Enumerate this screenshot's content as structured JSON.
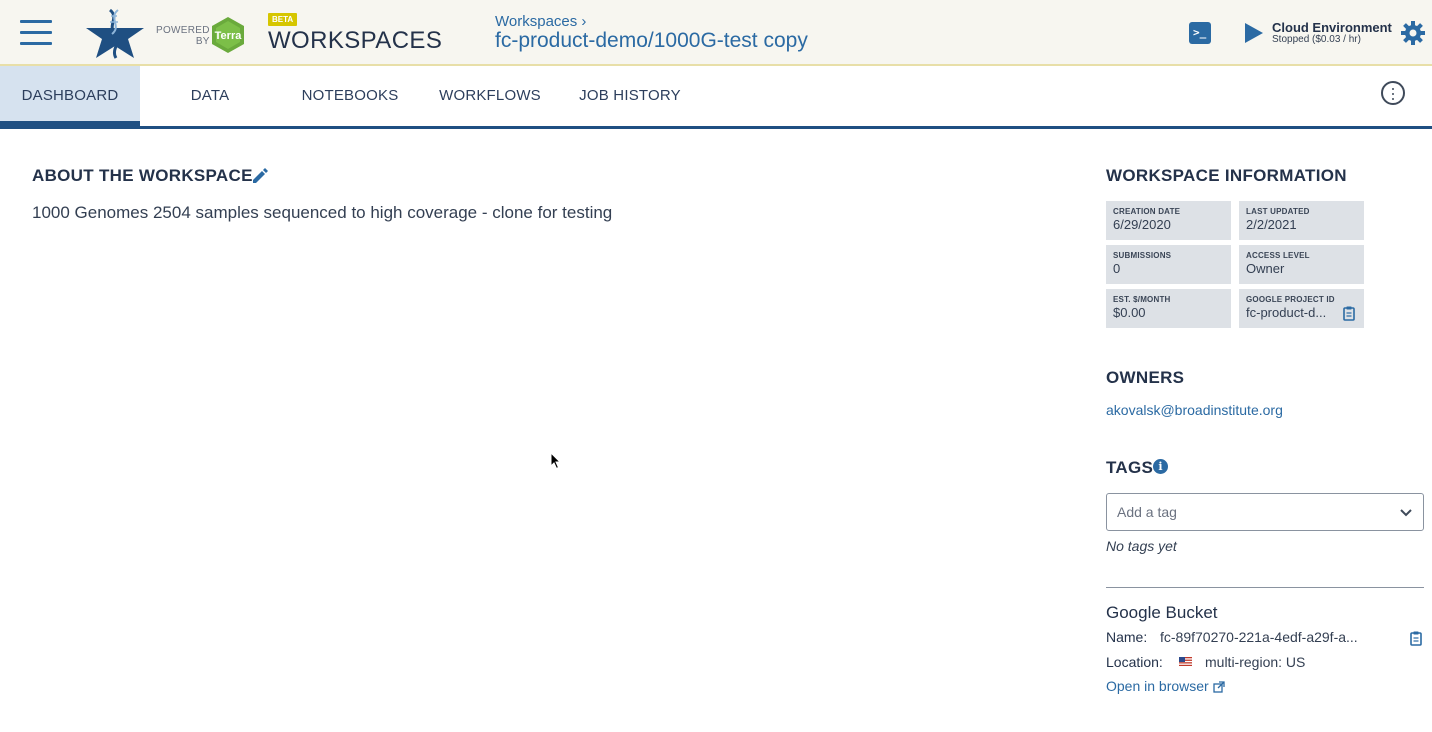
{
  "header": {
    "powered_line1": "POWERED",
    "powered_line2": "BY",
    "terra_label": "Terra",
    "beta_badge": "BETA",
    "app_title": "WORKSPACES",
    "breadcrumb": "Workspaces ›",
    "workspace_name": "fc-product-demo/1000G-test copy",
    "cloud_env_title": "Cloud Environment",
    "cloud_env_status": "Stopped ($0.03 / hr)"
  },
  "tabs": [
    {
      "label": "DASHBOARD",
      "active": true
    },
    {
      "label": "DATA",
      "active": false
    },
    {
      "label": "NOTEBOOKS",
      "active": false
    },
    {
      "label": "WORKFLOWS",
      "active": false
    },
    {
      "label": "JOB HISTORY",
      "active": false
    }
  ],
  "about": {
    "heading": "ABOUT THE WORKSPACE",
    "description": "1000 Genomes 2504 samples sequenced to high coverage - clone for testing"
  },
  "info": {
    "heading": "WORKSPACE INFORMATION",
    "fields": [
      {
        "label": "CREATION DATE",
        "value": "6/29/2020"
      },
      {
        "label": "LAST UPDATED",
        "value": "2/2/2021"
      },
      {
        "label": "SUBMISSIONS",
        "value": "0"
      },
      {
        "label": "ACCESS LEVEL",
        "value": "Owner"
      },
      {
        "label": "EST. $/MONTH",
        "value": "$0.00"
      },
      {
        "label": "GOOGLE PROJECT ID",
        "value": "fc-product-d..."
      }
    ]
  },
  "owners": {
    "heading": "OWNERS",
    "list": [
      "akovalsk@broadinstitute.org"
    ]
  },
  "tags": {
    "heading": "TAGS",
    "placeholder": "Add a tag",
    "empty_text": "No tags yet"
  },
  "bucket": {
    "heading": "Google Bucket",
    "name_label": "Name:",
    "name_value": "fc-89f70270-221a-4edf-a29f-a...",
    "location_label": "Location:",
    "location_value": "multi-region: US",
    "open_link": "Open in browser"
  },
  "colors": {
    "accent": "#2b6aa3",
    "header_bg": "#f7f6f0",
    "active_tab_bg": "#d6e2ef",
    "info_box_bg": "#dde1e6",
    "beta_badge": "#d6c600",
    "terra_green": "#6aaa3c"
  },
  "icons": [
    "hamburger-icon",
    "dna-logo-icon",
    "terra-hex-icon",
    "terminal-icon",
    "play-icon",
    "gear-icon",
    "kebab-menu-icon",
    "pencil-icon",
    "clipboard-icon",
    "info-icon",
    "chevron-down-icon",
    "us-flag-icon",
    "external-link-icon",
    "mouse-cursor-icon"
  ]
}
